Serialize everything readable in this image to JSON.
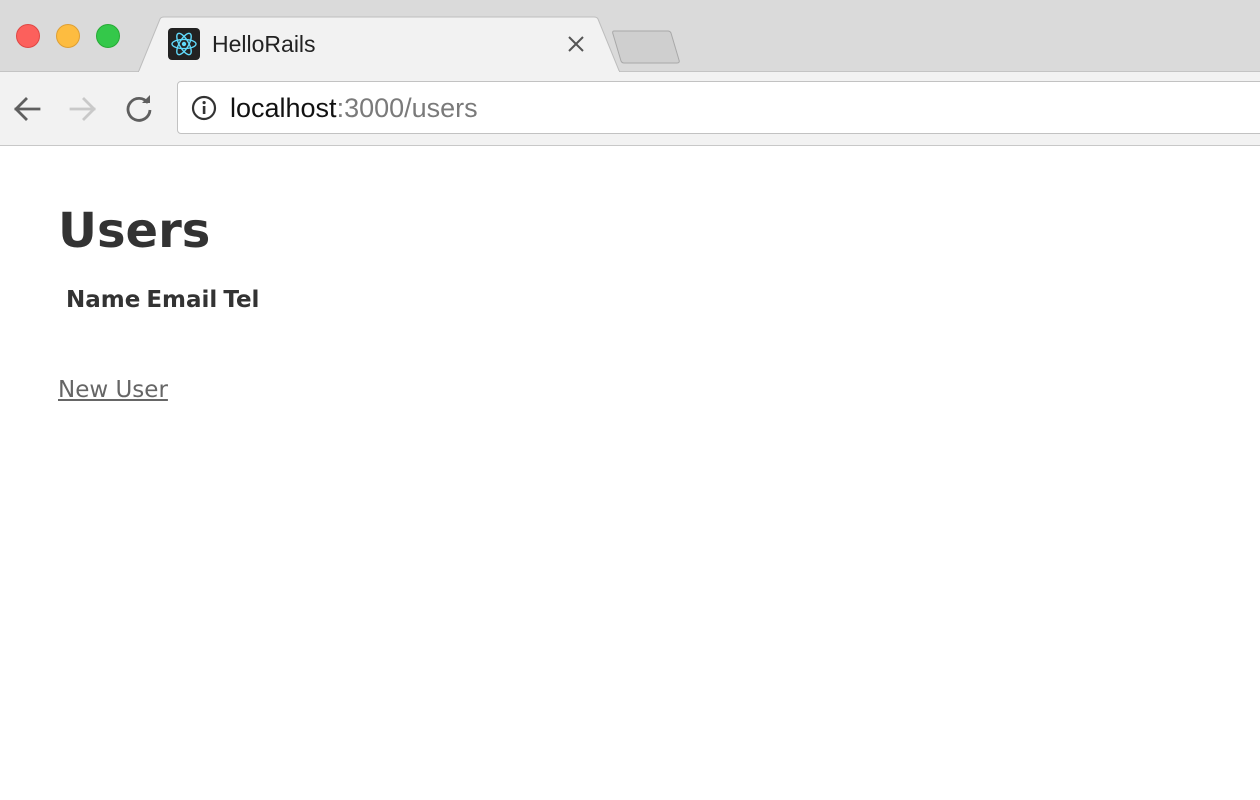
{
  "browser": {
    "window_controls": [
      "close",
      "minimize",
      "maximize"
    ],
    "tab": {
      "title": "HelloRails",
      "favicon": "react-atom-icon"
    },
    "address_bar": {
      "host": "localhost",
      "path": ":3000/users"
    },
    "colors": {
      "tab_strip": "#dadada",
      "toolbar": "#f2f2f2",
      "favicon_accent": "#61dafb"
    }
  },
  "page": {
    "title": "Users",
    "table": {
      "columns": [
        "Name",
        "Email",
        "Tel"
      ],
      "rows": []
    },
    "new_user_link": "New User"
  }
}
